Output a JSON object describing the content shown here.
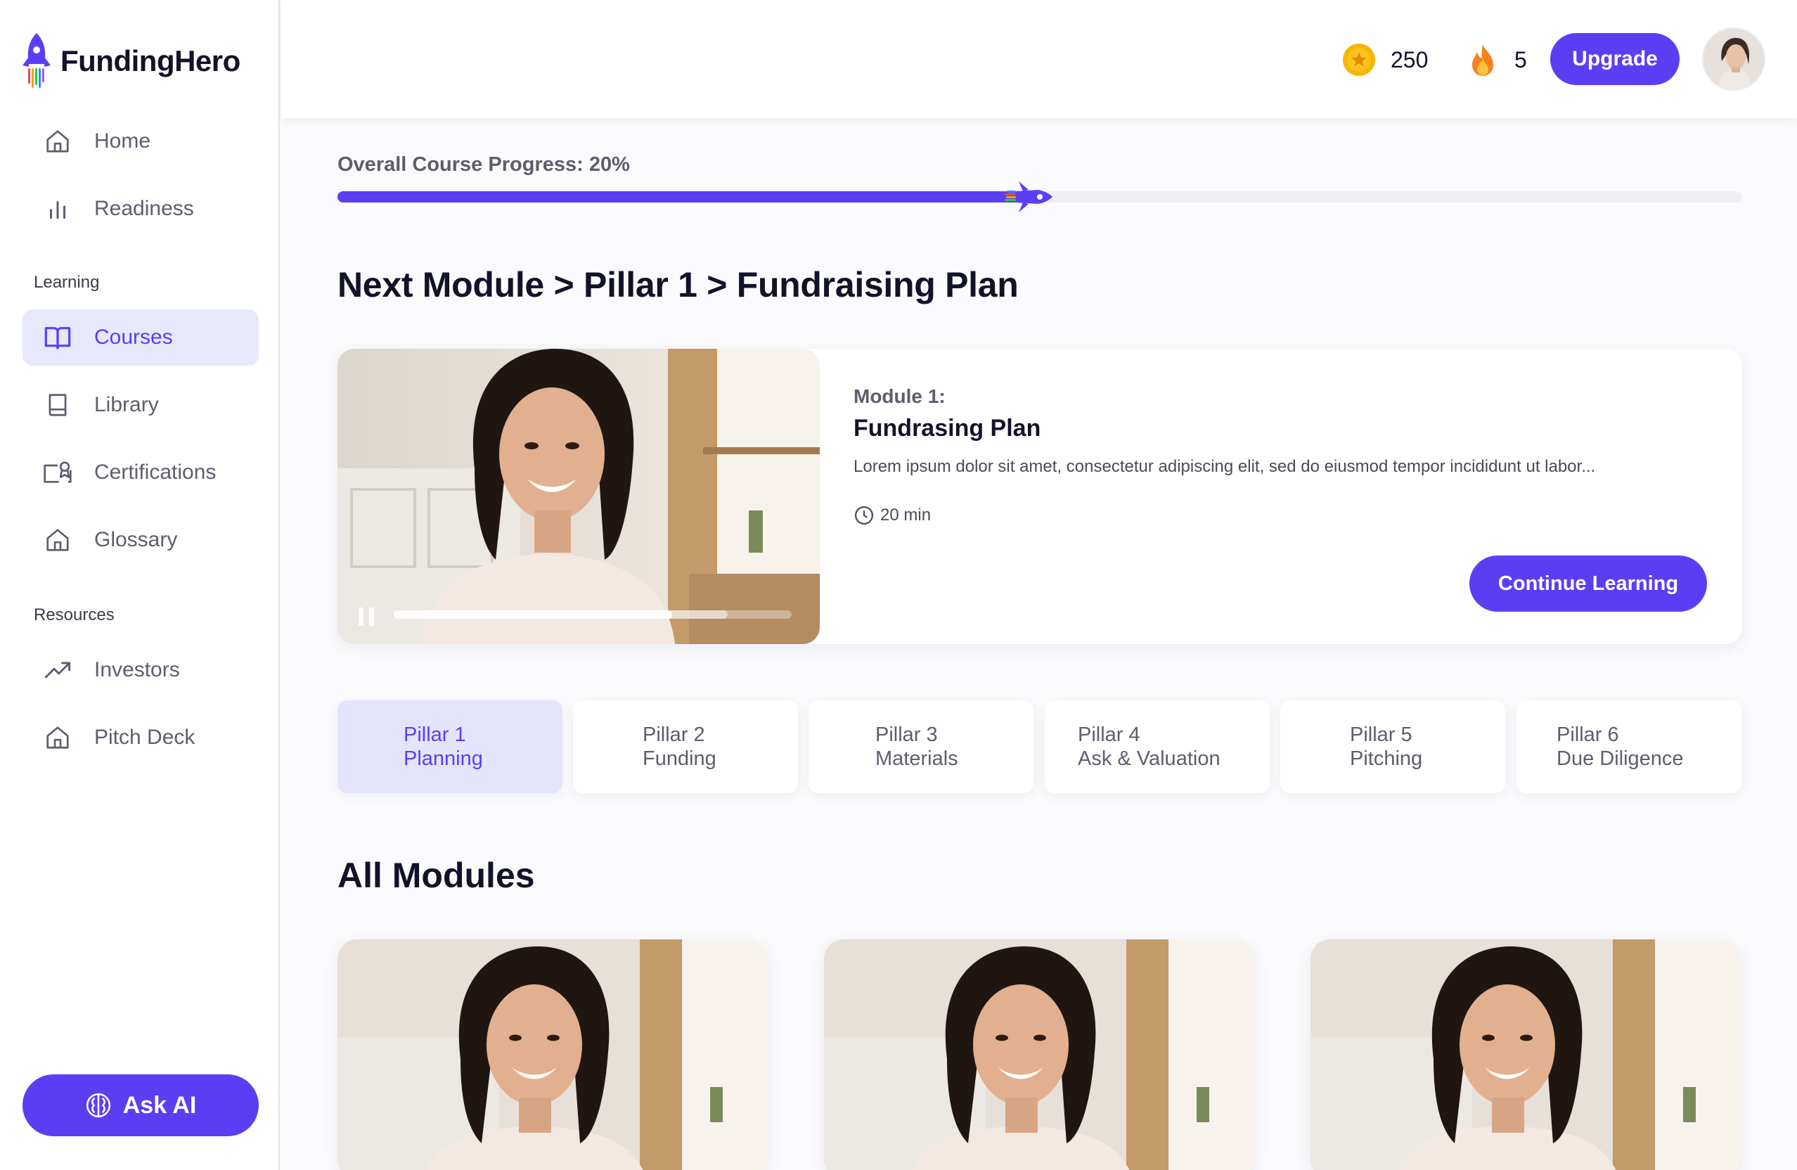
{
  "app": {
    "name": "FundingHero"
  },
  "sidebar": {
    "items": [
      {
        "label": "Home",
        "icon": "home-icon"
      },
      {
        "label": "Readiness",
        "icon": "bar-chart-icon"
      }
    ],
    "learning_section": "Learning",
    "learning_items": [
      {
        "label": "Courses",
        "icon": "open-book-icon",
        "active": true
      },
      {
        "label": "Library",
        "icon": "book-icon"
      },
      {
        "label": "Certifications",
        "icon": "certificate-icon"
      },
      {
        "label": "Glossary",
        "icon": "home-icon"
      }
    ],
    "resources_section": "Resources",
    "resources_items": [
      {
        "label": "Investors",
        "icon": "trending-up-icon"
      },
      {
        "label": "Pitch Deck",
        "icon": "home-icon"
      }
    ],
    "ask_ai_label": "Ask AI"
  },
  "topbar": {
    "coins": "250",
    "streak": "5",
    "upgrade_label": "Upgrade"
  },
  "course_progress": {
    "label": "Overall Course Progress:  20%",
    "value": 0.5
  },
  "next_module": {
    "heading": "Next Module > Pillar 1 > Fundraising Plan",
    "module_label": "Module 1:",
    "module_name": "Fundrasing Plan",
    "description": "Lorem ipsum dolor sit amet, consectetur adipiscing elit, sed do eiusmod tempor incididunt ut labor...",
    "duration": "20 min",
    "cta_label": "Continue Learning",
    "video_played": 0.7,
    "video_buffered": 0.84
  },
  "pillars": [
    {
      "line1": "Pillar 1",
      "line2": "Planning",
      "active": true
    },
    {
      "line1": "Pillar 2",
      "line2": "Funding"
    },
    {
      "line1": "Pillar 3",
      "line2": "Materials"
    },
    {
      "line1": "Pillar 4",
      "line2": "Ask & Valuation"
    },
    {
      "line1": "Pillar 5",
      "line2": "Pitching"
    },
    {
      "line1": "Pillar 6",
      "line2": "Due Diligence"
    }
  ],
  "all_modules": {
    "heading": "All Modules",
    "cards": 3
  },
  "colors": {
    "accent": "#5b3ef4",
    "active_bg": "#e8e8fd",
    "coin": "#f7b500",
    "fire": "#f5821f"
  }
}
